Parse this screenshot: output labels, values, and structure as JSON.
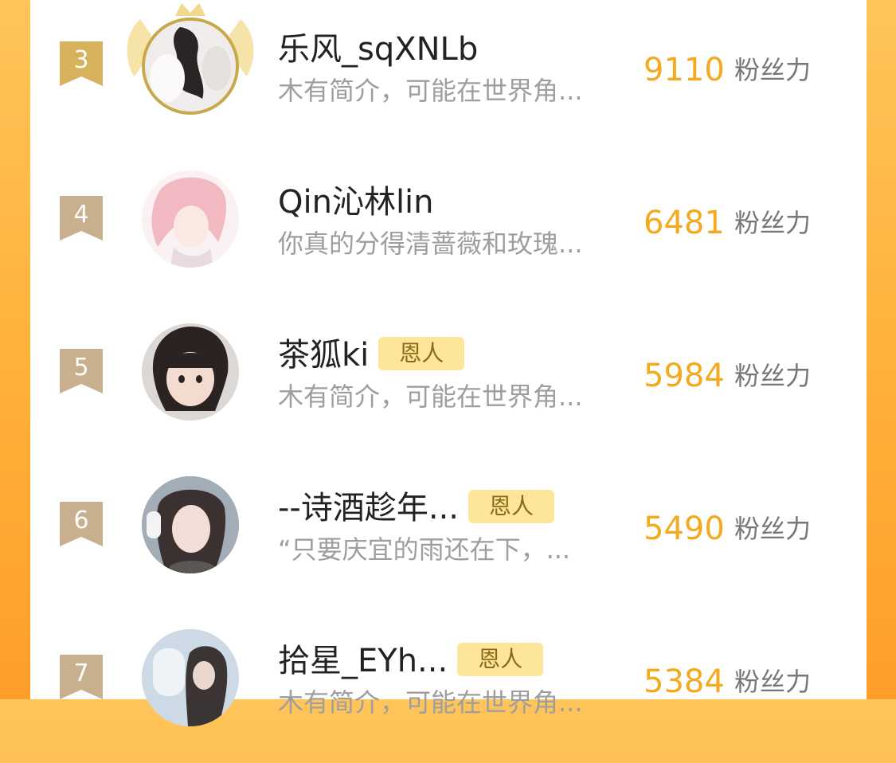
{
  "colors": {
    "background_top": "#ffc45a",
    "panel": "#ffffff",
    "score": "#f4a91e",
    "tag_bg": "#fde69a",
    "badge_gold": "#d6b25c",
    "badge_tan": "#c8b08f"
  },
  "rows": [
    {
      "rank": "3",
      "name": "乐风_sqXNLb",
      "tag": "",
      "bio": "木有简介，可能在世界角...",
      "score": "9110",
      "unit": "粉丝力"
    },
    {
      "rank": "4",
      "name": "Qin沁林lin",
      "tag": "",
      "bio": "你真的分得清蔷薇和玫瑰...",
      "score": "6481",
      "unit": "粉丝力"
    },
    {
      "rank": "5",
      "name": "茶狐ki",
      "tag": "恩人",
      "bio": "木有简介，可能在世界角...",
      "score": "5984",
      "unit": "粉丝力"
    },
    {
      "rank": "6",
      "name": "--诗酒趁年...",
      "tag": "恩人",
      "bio": "“只要庆宜的雨还在下，...",
      "score": "5490",
      "unit": "粉丝力"
    },
    {
      "rank": "7",
      "name": "拾星_EYh...",
      "tag": "恩人",
      "bio": "木有简介，可能在世界角...",
      "score": "5384",
      "unit": "粉丝力"
    }
  ]
}
